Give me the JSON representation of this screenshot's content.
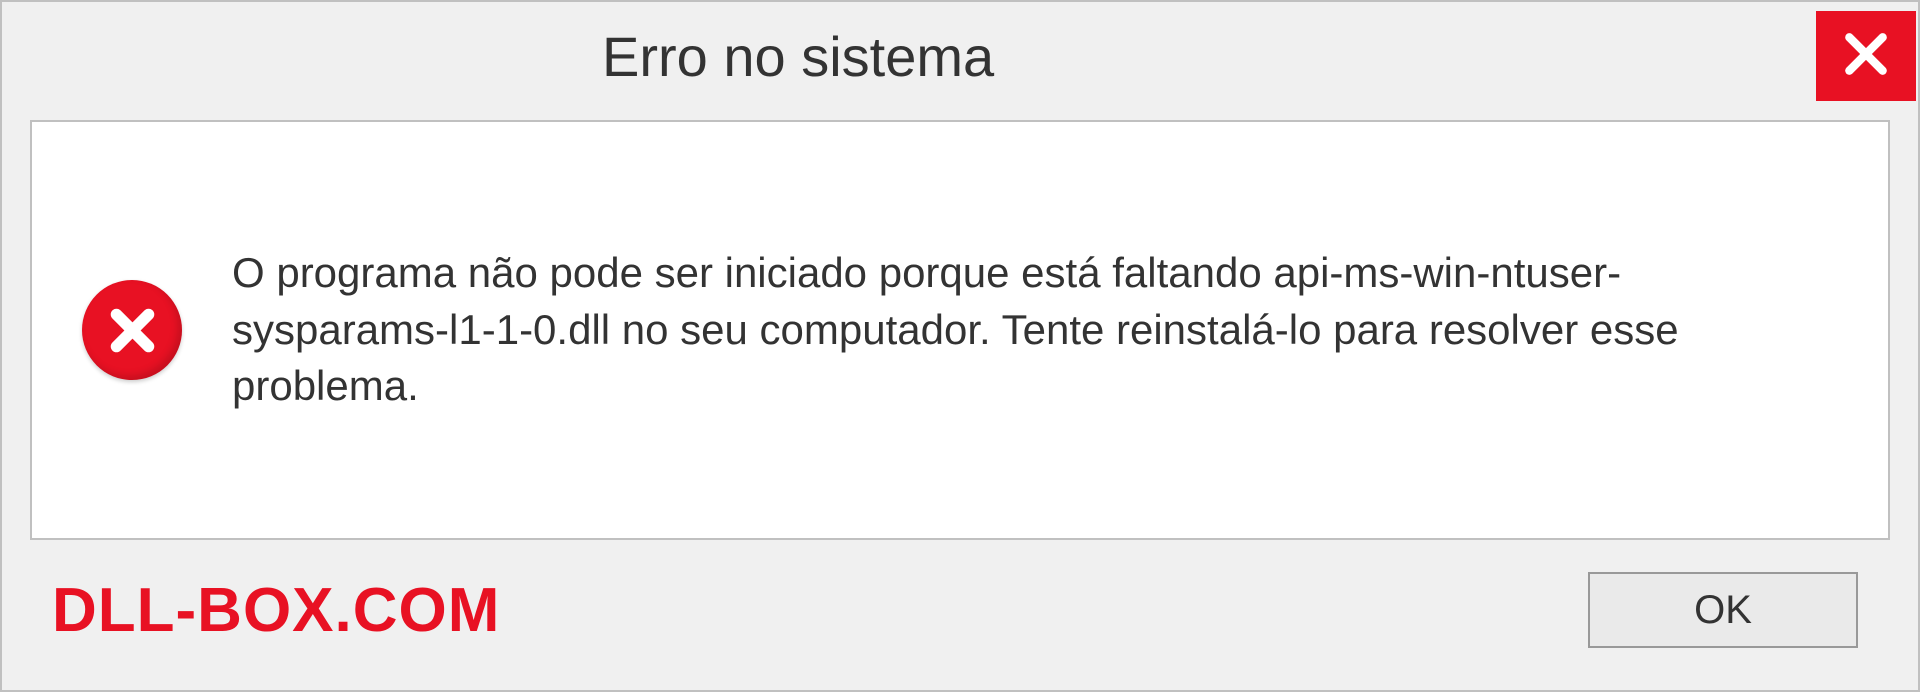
{
  "dialog": {
    "title": "Erro no sistema",
    "message": "O programa não pode ser iniciado porque está faltando api-ms-win-ntuser-sysparams-l1-1-0.dll no seu computador. Tente reinstalá-lo para resolver esse problema.",
    "ok_label": "OK"
  },
  "watermark": "DLL-BOX.COM",
  "colors": {
    "close_bg": "#e81123",
    "error_icon_bg": "#e81123",
    "watermark_color": "#e81123"
  }
}
